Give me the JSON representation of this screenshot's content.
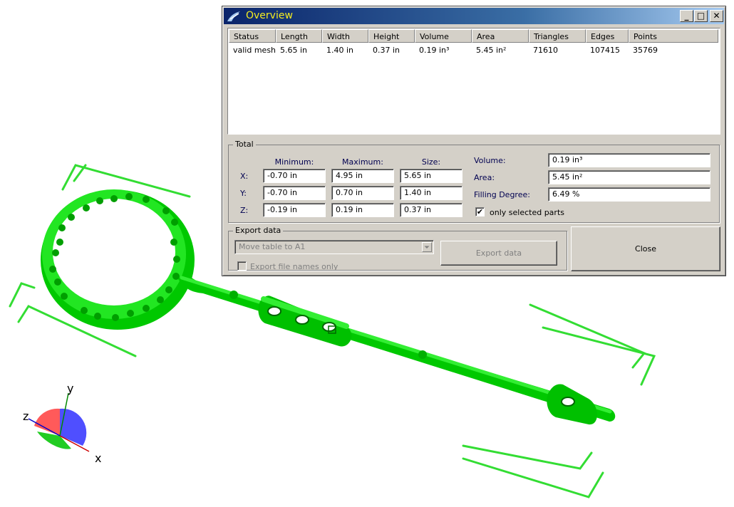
{
  "window": {
    "title": "Overview",
    "title_color": "#f4ec20",
    "minimize_label": "_",
    "maximize_label": "□",
    "close_label": "✕"
  },
  "table": {
    "columns": [
      "Status",
      "Length",
      "Width",
      "Height",
      "Volume",
      "Area",
      "Triangles",
      "Edges",
      "Points"
    ],
    "rows": [
      [
        "valid mesh",
        "5.65 in",
        "1.40 in",
        "0.37 in",
        "0.19 in³",
        "5.45 in²",
        "71610",
        "107415",
        "35769"
      ]
    ]
  },
  "total": {
    "label": "Total",
    "headers": {
      "minimum": "Minimum:",
      "maximum": "Maximum:",
      "size": "Size:"
    },
    "rows": [
      {
        "axis": "X:",
        "min": "-0.70 in",
        "max": "4.95 in",
        "size": "5.65 in"
      },
      {
        "axis": "Y:",
        "min": "-0.70 in",
        "max": "0.70 in",
        "size": "1.40 in"
      },
      {
        "axis": "Z:",
        "min": "-0.19 in",
        "max": "0.19 in",
        "size": "0.37 in"
      }
    ],
    "volume_label": "Volume:",
    "volume_value": "0.19 in³",
    "area_label": "Area:",
    "area_value": "5.45 in²",
    "filling_label": "Filling Degree:",
    "filling_value": "6.49 %",
    "only_selected_label": "only selected parts",
    "only_selected_checked": "✔"
  },
  "export": {
    "label": "Export data",
    "dropdown_value": "Move table to A1",
    "export_button": "Export data",
    "file_names_label": "Export file names only"
  },
  "close_button": "Close",
  "axes": {
    "x": "x",
    "y": "y",
    "z": "z"
  },
  "colors": {
    "mesh": "#00dd00",
    "bbox": "#33dd33",
    "title_gradient_start": "#0a246a",
    "dialog_bg": "#d4d0c8"
  }
}
